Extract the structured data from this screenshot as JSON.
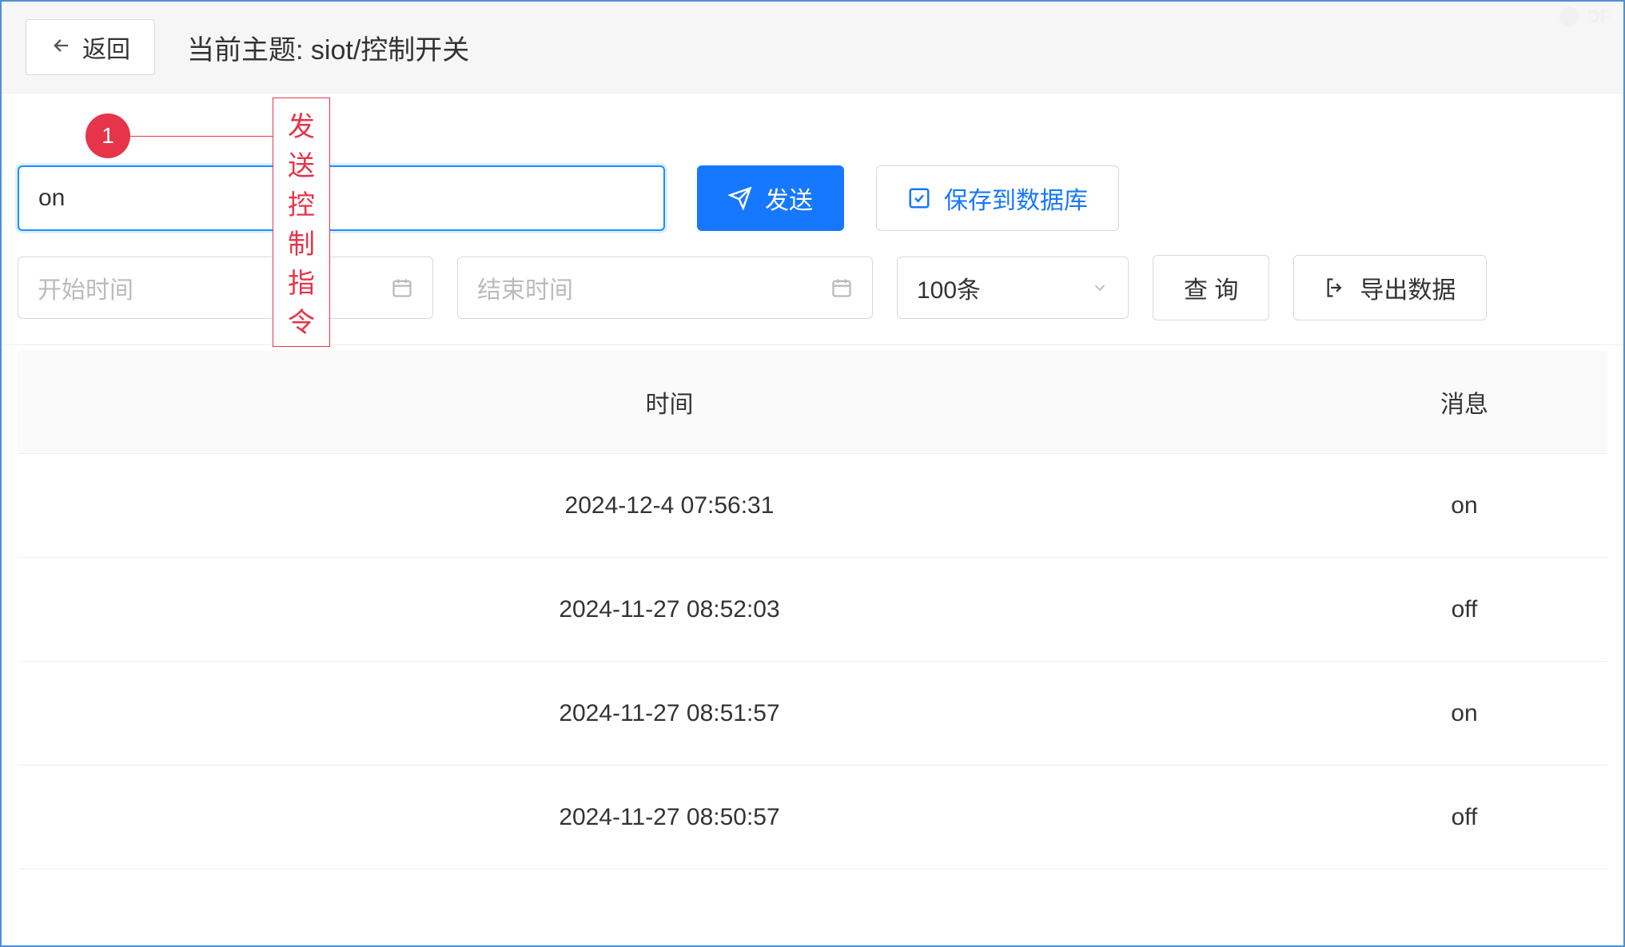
{
  "header": {
    "back_label": "返回",
    "topic_prefix": "当前主题: ",
    "topic_value": "siot/控制开关"
  },
  "annotation": {
    "badge_number": "1",
    "label": "发送控制指令"
  },
  "command": {
    "input_value": "on",
    "send_label": "发送",
    "save_label": "保存到数据库"
  },
  "filter": {
    "start_placeholder": "开始时间",
    "end_placeholder": "结束时间",
    "limit_selected": "100条",
    "query_label": "查 询",
    "export_label": "导出数据"
  },
  "table": {
    "time_header": "时间",
    "msg_header": "消息",
    "rows": [
      {
        "time": "2024-12-4 07:56:31",
        "msg": "on"
      },
      {
        "time": "2024-11-27 08:52:03",
        "msg": "off"
      },
      {
        "time": "2024-11-27 08:51:57",
        "msg": "on"
      },
      {
        "time": "2024-11-27 08:50:57",
        "msg": "off"
      }
    ]
  },
  "watermark": {
    "text": "DF"
  }
}
